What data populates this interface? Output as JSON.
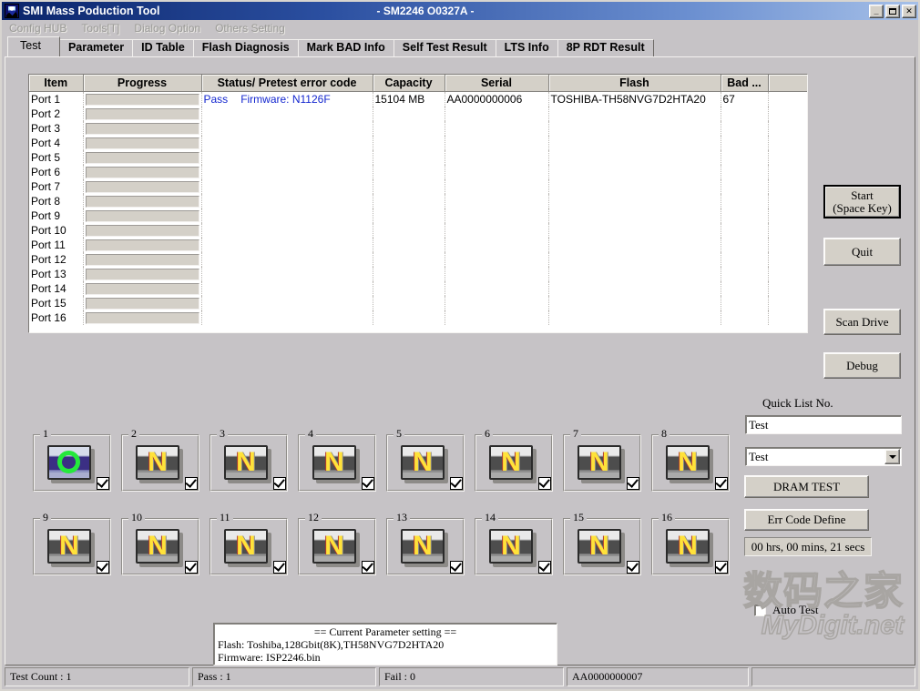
{
  "window": {
    "title": "SMI Mass Poduction Tool",
    "subtitle": "- SM2246 O0327A -",
    "icon": "app-icon",
    "buttons": {
      "minimize": "_",
      "maximize": "",
      "close": "✕"
    }
  },
  "menu": {
    "items": [
      {
        "label": "Config HUB"
      },
      {
        "label": "Tools[T]"
      },
      {
        "label": "Dialog Option"
      },
      {
        "label": "Others Setting"
      }
    ]
  },
  "tabs": [
    {
      "label": "Test",
      "active": true
    },
    {
      "label": "Parameter",
      "active": false
    },
    {
      "label": "ID Table",
      "active": false
    },
    {
      "label": "Flash Diagnosis",
      "active": false
    },
    {
      "label": "Mark BAD Info",
      "active": false
    },
    {
      "label": "Self Test Result",
      "active": false
    },
    {
      "label": "LTS Info",
      "active": false
    },
    {
      "label": "8P RDT Result",
      "active": false
    }
  ],
  "grid": {
    "columns": [
      "Item",
      "Progress",
      "Status/ Pretest error code",
      "Capacity",
      "Serial",
      "Flash",
      "Bad ...",
      ""
    ],
    "rows": [
      {
        "item": "Port 1",
        "progress": "",
        "status": "Pass",
        "firmware": "Firmware: N1126F",
        "capacity": "15104 MB",
        "serial": "AA0000000006",
        "flash": "TOSHIBA-TH58NVG7D2HTA20",
        "bad": "67"
      },
      {
        "item": "Port 2",
        "progress": "",
        "status": "",
        "firmware": "",
        "capacity": "",
        "serial": "",
        "flash": "",
        "bad": ""
      },
      {
        "item": "Port 3",
        "progress": "",
        "status": "",
        "firmware": "",
        "capacity": "",
        "serial": "",
        "flash": "",
        "bad": ""
      },
      {
        "item": "Port 4",
        "progress": "",
        "status": "",
        "firmware": "",
        "capacity": "",
        "serial": "",
        "flash": "",
        "bad": ""
      },
      {
        "item": "Port 5",
        "progress": "",
        "status": "",
        "firmware": "",
        "capacity": "",
        "serial": "",
        "flash": "",
        "bad": ""
      },
      {
        "item": "Port 6",
        "progress": "",
        "status": "",
        "firmware": "",
        "capacity": "",
        "serial": "",
        "flash": "",
        "bad": ""
      },
      {
        "item": "Port 7",
        "progress": "",
        "status": "",
        "firmware": "",
        "capacity": "",
        "serial": "",
        "flash": "",
        "bad": ""
      },
      {
        "item": "Port 8",
        "progress": "",
        "status": "",
        "firmware": "",
        "capacity": "",
        "serial": "",
        "flash": "",
        "bad": ""
      },
      {
        "item": "Port 9",
        "progress": "",
        "status": "",
        "firmware": "",
        "capacity": "",
        "serial": "",
        "flash": "",
        "bad": ""
      },
      {
        "item": "Port 10",
        "progress": "",
        "status": "",
        "firmware": "",
        "capacity": "",
        "serial": "",
        "flash": "",
        "bad": ""
      },
      {
        "item": "Port 11",
        "progress": "",
        "status": "",
        "firmware": "",
        "capacity": "",
        "serial": "",
        "flash": "",
        "bad": ""
      },
      {
        "item": "Port 12",
        "progress": "",
        "status": "",
        "firmware": "",
        "capacity": "",
        "serial": "",
        "flash": "",
        "bad": ""
      },
      {
        "item": "Port 13",
        "progress": "",
        "status": "",
        "firmware": "",
        "capacity": "",
        "serial": "",
        "flash": "",
        "bad": ""
      },
      {
        "item": "Port 14",
        "progress": "",
        "status": "",
        "firmware": "",
        "capacity": "",
        "serial": "",
        "flash": "",
        "bad": ""
      },
      {
        "item": "Port 15",
        "progress": "",
        "status": "",
        "firmware": "",
        "capacity": "",
        "serial": "",
        "flash": "",
        "bad": ""
      },
      {
        "item": "Port 16",
        "progress": "",
        "status": "",
        "firmware": "",
        "capacity": "",
        "serial": "",
        "flash": "",
        "bad": ""
      }
    ]
  },
  "actions": {
    "start": "Start\n(Space Key)",
    "start_line1": "Start",
    "start_line2": "(Space Key)",
    "quit": "Quit",
    "scan_drive": "Scan Drive",
    "debug": "Debug"
  },
  "quicklist": {
    "label": "Quick List No.",
    "textbox_value": "Test",
    "combo_value": "Test",
    "dram_test": "DRAM TEST",
    "err_code_define": "Err Code Define",
    "elapsed": "00 hrs, 00 mins, 21 secs",
    "auto_test_label": "Auto Test",
    "auto_test_checked": false
  },
  "tiles": [
    {
      "num": "1",
      "state": "off",
      "glyph": "O",
      "checked": true
    },
    {
      "num": "2",
      "state": "on",
      "glyph": "N",
      "checked": true
    },
    {
      "num": "3",
      "state": "on",
      "glyph": "N",
      "checked": true
    },
    {
      "num": "4",
      "state": "on",
      "glyph": "N",
      "checked": true
    },
    {
      "num": "5",
      "state": "on",
      "glyph": "N",
      "checked": true
    },
    {
      "num": "6",
      "state": "on",
      "glyph": "N",
      "checked": true
    },
    {
      "num": "7",
      "state": "on",
      "glyph": "N",
      "checked": true
    },
    {
      "num": "8",
      "state": "on",
      "glyph": "N",
      "checked": true
    },
    {
      "num": "9",
      "state": "on",
      "glyph": "N",
      "checked": true
    },
    {
      "num": "10",
      "state": "on",
      "glyph": "N",
      "checked": true
    },
    {
      "num": "11",
      "state": "on",
      "glyph": "N",
      "checked": true
    },
    {
      "num": "12",
      "state": "on",
      "glyph": "N",
      "checked": true
    },
    {
      "num": "13",
      "state": "on",
      "glyph": "N",
      "checked": true
    },
    {
      "num": "14",
      "state": "on",
      "glyph": "N",
      "checked": true
    },
    {
      "num": "15",
      "state": "on",
      "glyph": "N",
      "checked": true
    },
    {
      "num": "16",
      "state": "on",
      "glyph": "N",
      "checked": true
    }
  ],
  "parameter_box": {
    "title": "== Current Parameter setting ==",
    "flash": "Flash:   Toshiba,128Gbit(8K),TH58NVG7D2HTA20",
    "firmware": "Firmware:  ISP2246.bin"
  },
  "watermark": {
    "line1": "数码之家",
    "line2": "MyDigit.net"
  },
  "statusbar": {
    "test_count": "Test Count : 1",
    "pass": "Pass : 1",
    "fail": "Fail : 0",
    "serial": "AA0000000007",
    "extra": ""
  },
  "colors": {
    "pass_text": "#1326cf",
    "accent_title": "#0a246a",
    "face": "#c6c3c6",
    "glyph_n": "#ffe23a",
    "glyph_o": "#25e83c"
  }
}
